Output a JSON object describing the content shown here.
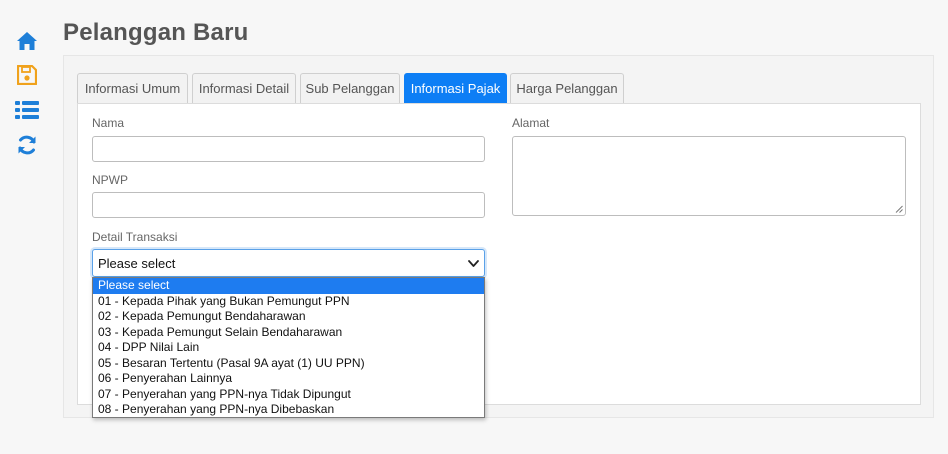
{
  "colors": {
    "accent": "#0d7ef5",
    "icon_blue": "#1e7fd8",
    "icon_orange": "#f0a21c",
    "selected_option": "#1e7cf0"
  },
  "sidebar": {
    "icons": [
      {
        "name": "home-icon"
      },
      {
        "name": "save-icon"
      },
      {
        "name": "list-icon"
      },
      {
        "name": "refresh-icon"
      }
    ]
  },
  "page": {
    "title": "Pelanggan Baru"
  },
  "tabs": [
    {
      "label": "Informasi Umum",
      "active": false
    },
    {
      "label": "Informasi Detail",
      "active": false
    },
    {
      "label": "Sub Pelanggan",
      "active": false
    },
    {
      "label": "Informasi Pajak",
      "active": true
    },
    {
      "label": "Harga Pelanggan",
      "active": false
    }
  ],
  "form": {
    "nama": {
      "label": "Nama",
      "value": ""
    },
    "npwp": {
      "label": "NPWP",
      "value": ""
    },
    "alamat": {
      "label": "Alamat",
      "value": ""
    },
    "detail_transaksi": {
      "label": "Detail Transaksi",
      "selected": "Please select",
      "options": [
        "Please select",
        "01 - Kepada Pihak yang Bukan Pemungut PPN",
        "02 - Kepada Pemungut Bendaharawan",
        "03 - Kepada Pemungut Selain Bendaharawan",
        "04 - DPP Nilai Lain",
        "05 - Besaran Tertentu (Pasal 9A ayat (1) UU PPN)",
        "06 - Penyerahan Lainnya",
        "07 - Penyerahan yang PPN-nya Tidak Dipungut",
        "08 - Penyerahan yang PPN-nya Dibebaskan"
      ]
    }
  }
}
